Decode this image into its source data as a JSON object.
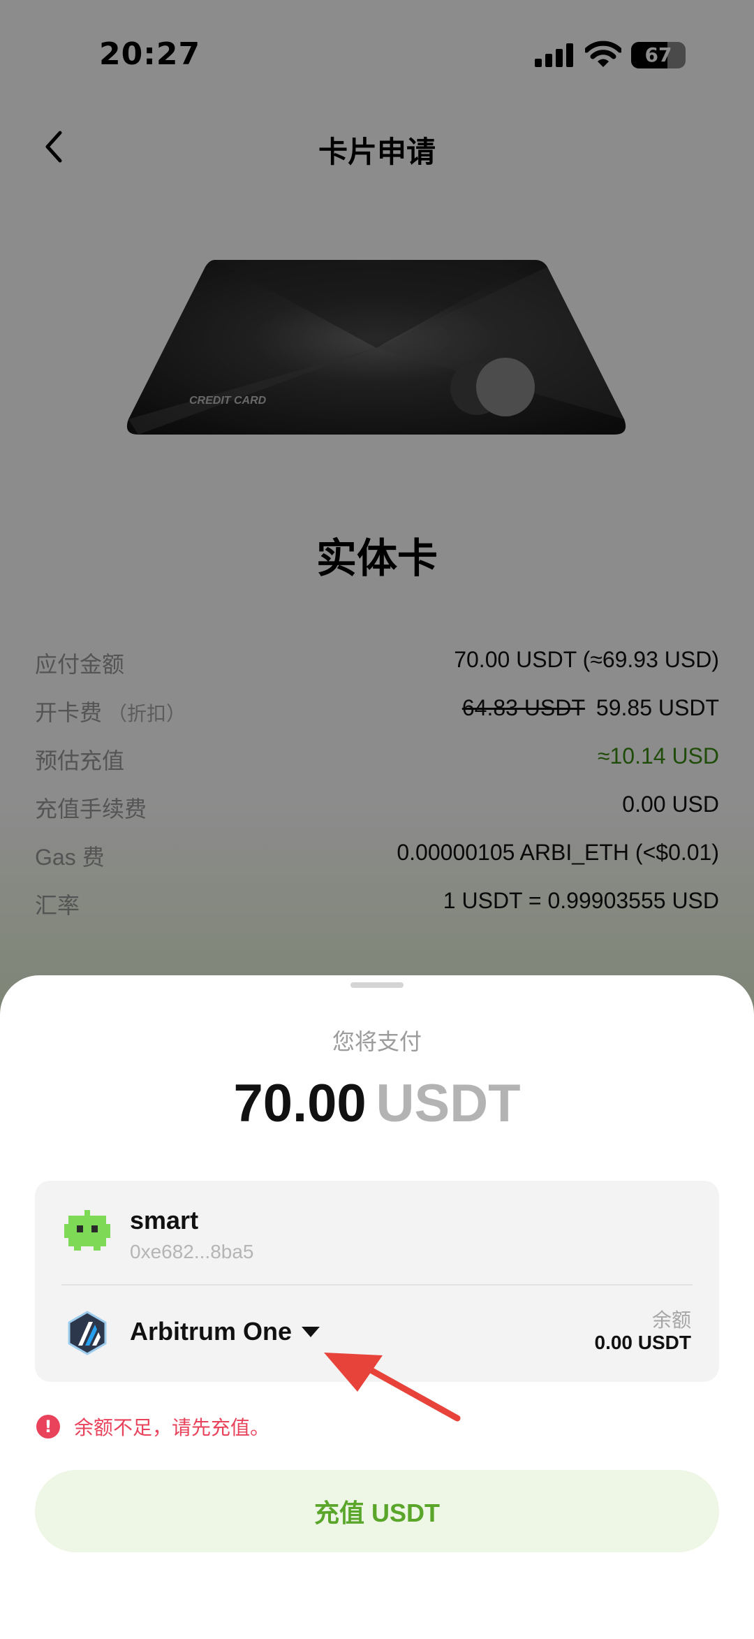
{
  "status_bar": {
    "time": "20:27",
    "battery": "67",
    "battery_level": 0.67
  },
  "nav": {
    "title": "卡片申请",
    "back_icon": "chevron-left-icon"
  },
  "card": {
    "image_text": "CREDIT CARD",
    "title": "实体卡"
  },
  "info": {
    "amount_due_label": "应付金额",
    "amount_due_value": "70.00 USDT (≈69.93 USD)",
    "card_fee_label": "开卡费",
    "card_fee_sub": "（折扣）",
    "card_fee_original": "64.83 USDT",
    "card_fee_value": "59.85 USDT",
    "est_topup_label": "预估充值",
    "est_topup_value": "≈10.14 USD",
    "topup_fee_label": "充值手续费",
    "topup_fee_value": "0.00 USD",
    "gas_label": "Gas 费",
    "gas_value": "0.00000105 ARBI_ETH (<$0.01)",
    "rate_label": "汇率",
    "rate_value": "1 USDT = 0.99903555 USD"
  },
  "sheet": {
    "pay_label": "您将支付",
    "amount": "70.00",
    "unit": "USDT",
    "wallet": {
      "name": "smart",
      "address": "0xe682...8ba5",
      "icon": "robot-icon"
    },
    "network": {
      "name": "Arbitrum One",
      "icon": "arbitrum-icon"
    },
    "balance_label": "余额",
    "balance_value": "0.00 USDT",
    "error": "余额不足，请先充值。",
    "topup_button": "充值 USDT"
  },
  "colors": {
    "accent_green": "#59a62a",
    "error_red": "#e9435c",
    "positive_green": "#3b8b12",
    "annotation_arrow": "#e8433a"
  }
}
